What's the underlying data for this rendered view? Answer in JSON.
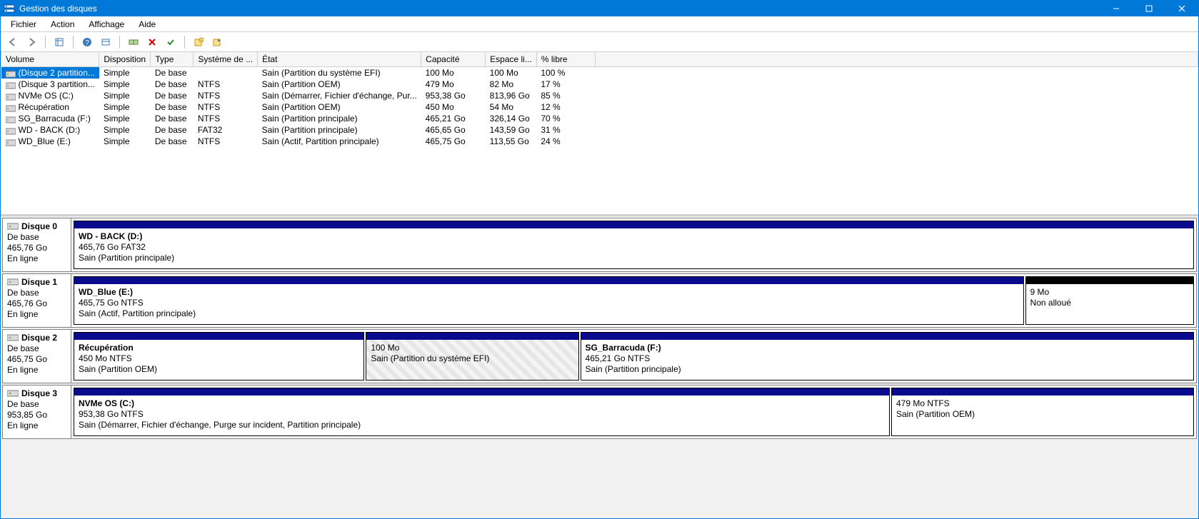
{
  "window": {
    "title": "Gestion des disques"
  },
  "menu": {
    "file": "Fichier",
    "action": "Action",
    "view": "Affichage",
    "help": "Aide"
  },
  "table": {
    "headers": {
      "volume": "Volume",
      "disposition": "Disposition",
      "type": "Type",
      "fs": "Système de ...",
      "state": "État",
      "capacity": "Capacité",
      "free": "Espace li...",
      "pct": "% libre"
    },
    "rows": [
      {
        "volume": "(Disque 2 partition...",
        "disposition": "Simple",
        "type": "De base",
        "fs": "",
        "state": "Sain (Partition du système EFI)",
        "capacity": "100 Mo",
        "free": "100 Mo",
        "pct": "100 %",
        "selected": true
      },
      {
        "volume": "(Disque 3 partition...",
        "disposition": "Simple",
        "type": "De base",
        "fs": "NTFS",
        "state": "Sain (Partition OEM)",
        "capacity": "479 Mo",
        "free": "82 Mo",
        "pct": "17 %"
      },
      {
        "volume": "NVMe OS (C:)",
        "disposition": "Simple",
        "type": "De base",
        "fs": "NTFS",
        "state": "Sain (Démarrer, Fichier d'échange, Pur...",
        "capacity": "953,38 Go",
        "free": "813,96 Go",
        "pct": "85 %"
      },
      {
        "volume": "Récupération",
        "disposition": "Simple",
        "type": "De base",
        "fs": "NTFS",
        "state": "Sain (Partition OEM)",
        "capacity": "450 Mo",
        "free": "54 Mo",
        "pct": "12 %"
      },
      {
        "volume": "SG_Barracuda  (F:)",
        "disposition": "Simple",
        "type": "De base",
        "fs": "NTFS",
        "state": "Sain (Partition principale)",
        "capacity": "465,21 Go",
        "free": "326,14 Go",
        "pct": "70 %"
      },
      {
        "volume": "WD - BACK (D:)",
        "disposition": "Simple",
        "type": "De base",
        "fs": "FAT32",
        "state": "Sain (Partition principale)",
        "capacity": "465,65 Go",
        "free": "143,59 Go",
        "pct": "31 %"
      },
      {
        "volume": "WD_Blue (E:)",
        "disposition": "Simple",
        "type": "De base",
        "fs": "NTFS",
        "state": "Sain (Actif, Partition principale)",
        "capacity": "465,75 Go",
        "free": "113,55 Go",
        "pct": "24 %"
      }
    ]
  },
  "disks": [
    {
      "name": "Disque 0",
      "type": "De base",
      "size": "465,76 Go",
      "status": "En ligne",
      "partitions": [
        {
          "title": "WD - BACK  (D:)",
          "line2": "465,76 Go FAT32",
          "line3": "Sain (Partition principale)",
          "flex": 100,
          "style": "primary"
        }
      ]
    },
    {
      "name": "Disque 1",
      "type": "De base",
      "size": "465,76 Go",
      "status": "En ligne",
      "partitions": [
        {
          "title": "WD_Blue  (E:)",
          "line2": "465,75 Go NTFS",
          "line3": "Sain (Actif, Partition principale)",
          "flex": 85,
          "style": "primary"
        },
        {
          "title": "",
          "line2": "9 Mo",
          "line3": "Non alloué",
          "flex": 15,
          "style": "unalloc"
        }
      ]
    },
    {
      "name": "Disque 2",
      "type": "De base",
      "size": "465,75 Go",
      "status": "En ligne",
      "partitions": [
        {
          "title": "Récupération",
          "line2": "450 Mo NTFS",
          "line3": "Sain (Partition OEM)",
          "flex": 26,
          "style": "primary"
        },
        {
          "title": "",
          "line2": "100 Mo",
          "line3": "Sain (Partition du système EFI)",
          "flex": 19,
          "style": "efi"
        },
        {
          "title": "SG_Barracuda   (F:)",
          "line2": "465,21 Go NTFS",
          "line3": "Sain (Partition principale)",
          "flex": 55,
          "style": "primary"
        }
      ]
    },
    {
      "name": "Disque 3",
      "type": "De base",
      "size": "953,85 Go",
      "status": "En ligne",
      "partitions": [
        {
          "title": "NVMe OS  (C:)",
          "line2": "953,38 Go NTFS",
          "line3": "Sain (Démarrer, Fichier d'échange, Purge sur incident, Partition principale)",
          "flex": 73,
          "style": "primary"
        },
        {
          "title": "",
          "line2": "479 Mo NTFS",
          "line3": "Sain (Partition OEM)",
          "flex": 27,
          "style": "primary"
        }
      ]
    }
  ]
}
